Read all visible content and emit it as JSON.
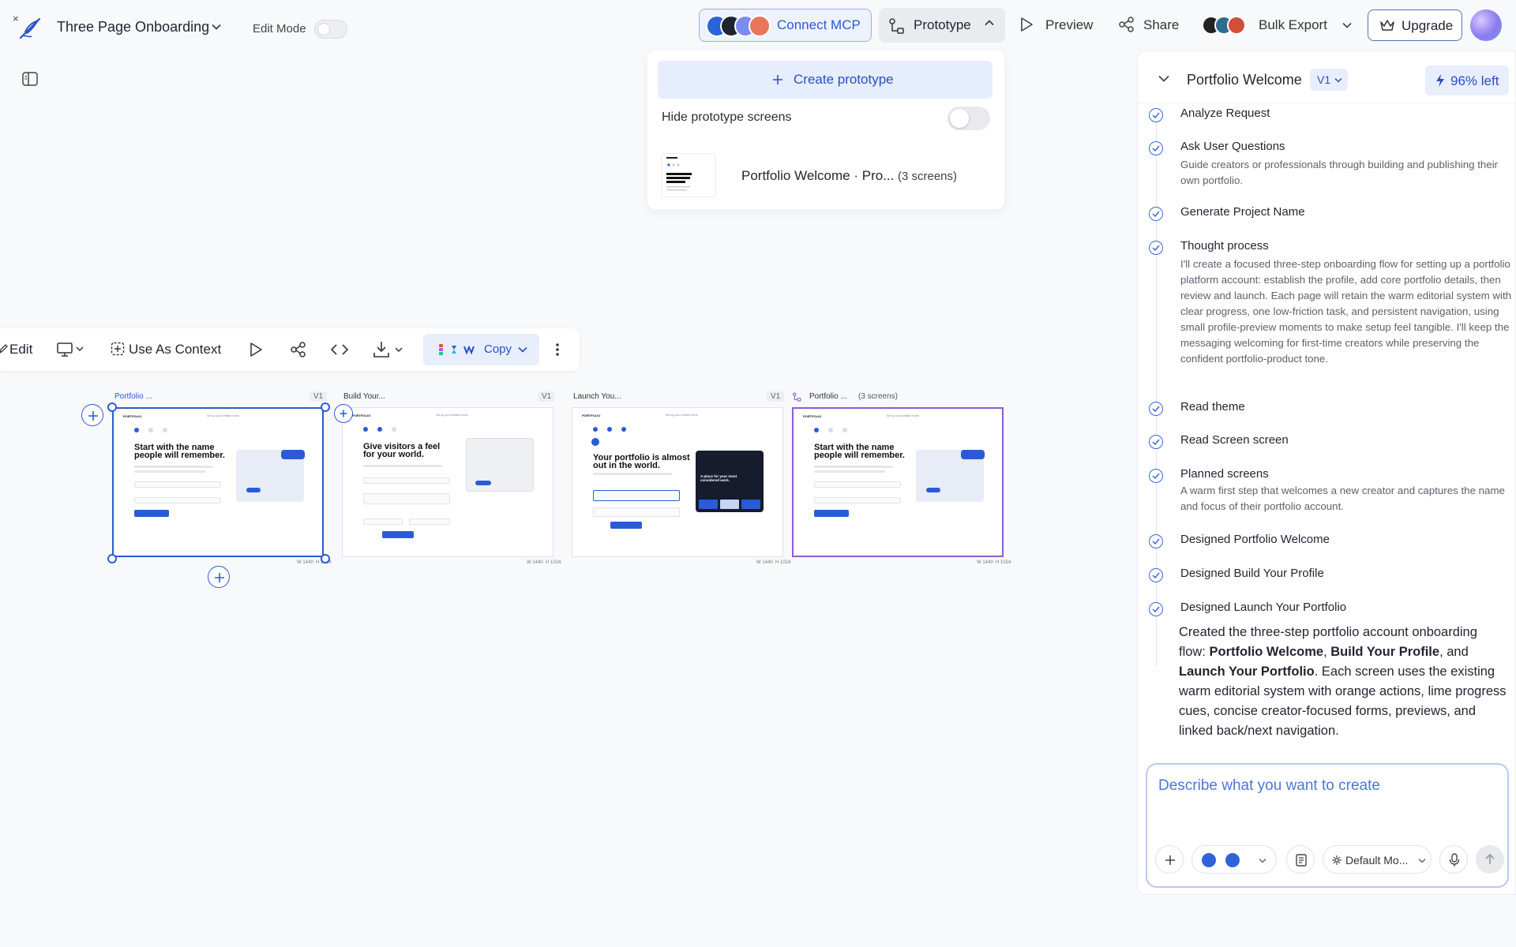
{
  "app": {
    "project_title": "Three Page Onboarding",
    "edit_mode_label": "Edit Mode",
    "close_glyph": "×"
  },
  "topbar": {
    "connect_mcp_label": "Connect MCP",
    "prototype_label": "Prototype",
    "preview_label": "Preview",
    "share_label": "Share",
    "bulk_export_label": "Bulk Export",
    "upgrade_label": "Upgrade"
  },
  "prototype_panel": {
    "create_label": "Create prototype",
    "hide_screens_label": "Hide prototype screens",
    "hide_screens_on": false,
    "item_name": "Portfolio Welcome · Pro...",
    "item_count": "(3 screens)"
  },
  "screen_toolbar": {
    "edit_label": "Edit",
    "context_label": "Use As Context",
    "copy_label": "Copy"
  },
  "frames": [
    {
      "title": "Portfolio ...",
      "badge": "V1",
      "heading": "Start with the name people will remember.",
      "meta_w": "W 1440",
      "meta_h": "H 1024"
    },
    {
      "title": "Build Your...",
      "badge": "V1",
      "heading": "Give visitors a feel for your world.",
      "meta_w": "W 1440",
      "meta_h": "H 1024"
    },
    {
      "title": "Launch You...",
      "badge": "V1",
      "heading": "Your portfolio is almost out in the world.",
      "meta_w": "W 1440",
      "meta_h": "H 1024"
    },
    {
      "title": "Portfolio ...",
      "badge": "(3 screens)",
      "heading": "Start with the name people will remember.",
      "meta_w": "W 1440",
      "meta_h": "H 1024"
    }
  ],
  "mini": {
    "logo": "PORTFOLIO",
    "nav": "Set up your creative home",
    "launch_card": "A place for your most considered work."
  },
  "chat": {
    "title": "Portfolio Welcome",
    "version": "V1",
    "credits": "96% left",
    "steps": [
      {
        "title": "Analyze Request",
        "desc": ""
      },
      {
        "title": "Ask User Questions",
        "desc": "Guide creators or professionals through building and publishing their own portfolio."
      },
      {
        "title": "Generate Project Name",
        "desc": ""
      },
      {
        "title": "Thought process",
        "desc": "I'll create a focused three-step onboarding flow for setting up a portfolio platform account: establish the profile, add core portfolio details, then review and launch. Each page will retain the warm editorial system with clear progress, one low-friction task, and persistent navigation, using small profile-preview moments to make setup feel tangible. I'll keep the messaging welcoming for first-time creators while preserving the confident portfolio-product tone."
      },
      {
        "title": "Read theme",
        "desc": ""
      },
      {
        "title": "Read Screen screen",
        "desc": ""
      },
      {
        "title": "Planned screens",
        "desc": "A warm first step that welcomes a new creator and captures the name and focus of their portfolio account."
      },
      {
        "title": "Designed Portfolio Welcome",
        "desc": ""
      },
      {
        "title": "Designed Build Your Profile",
        "desc": ""
      },
      {
        "title": "Designed Launch Your Portfolio",
        "desc": ""
      }
    ],
    "summary": {
      "intro": "Created the three-step portfolio account onboarding flow: ",
      "s1": "Portfolio Welcome",
      "sep1": ", ",
      "s2": "Build Your Profile",
      "sep2": ", and ",
      "s3": "Launch Your Portfolio",
      "rest": ". Each screen uses the existing warm editorial system with orange actions, lime progress cues, concise creator-focused forms, previews, and linked back/next navigation."
    },
    "composer_placeholder": "Describe what you want to create",
    "model_label": "Default Mo..."
  },
  "colors": {
    "accent_blue": "#2a5bd7",
    "prototype_purple": "#8d5bd9"
  }
}
